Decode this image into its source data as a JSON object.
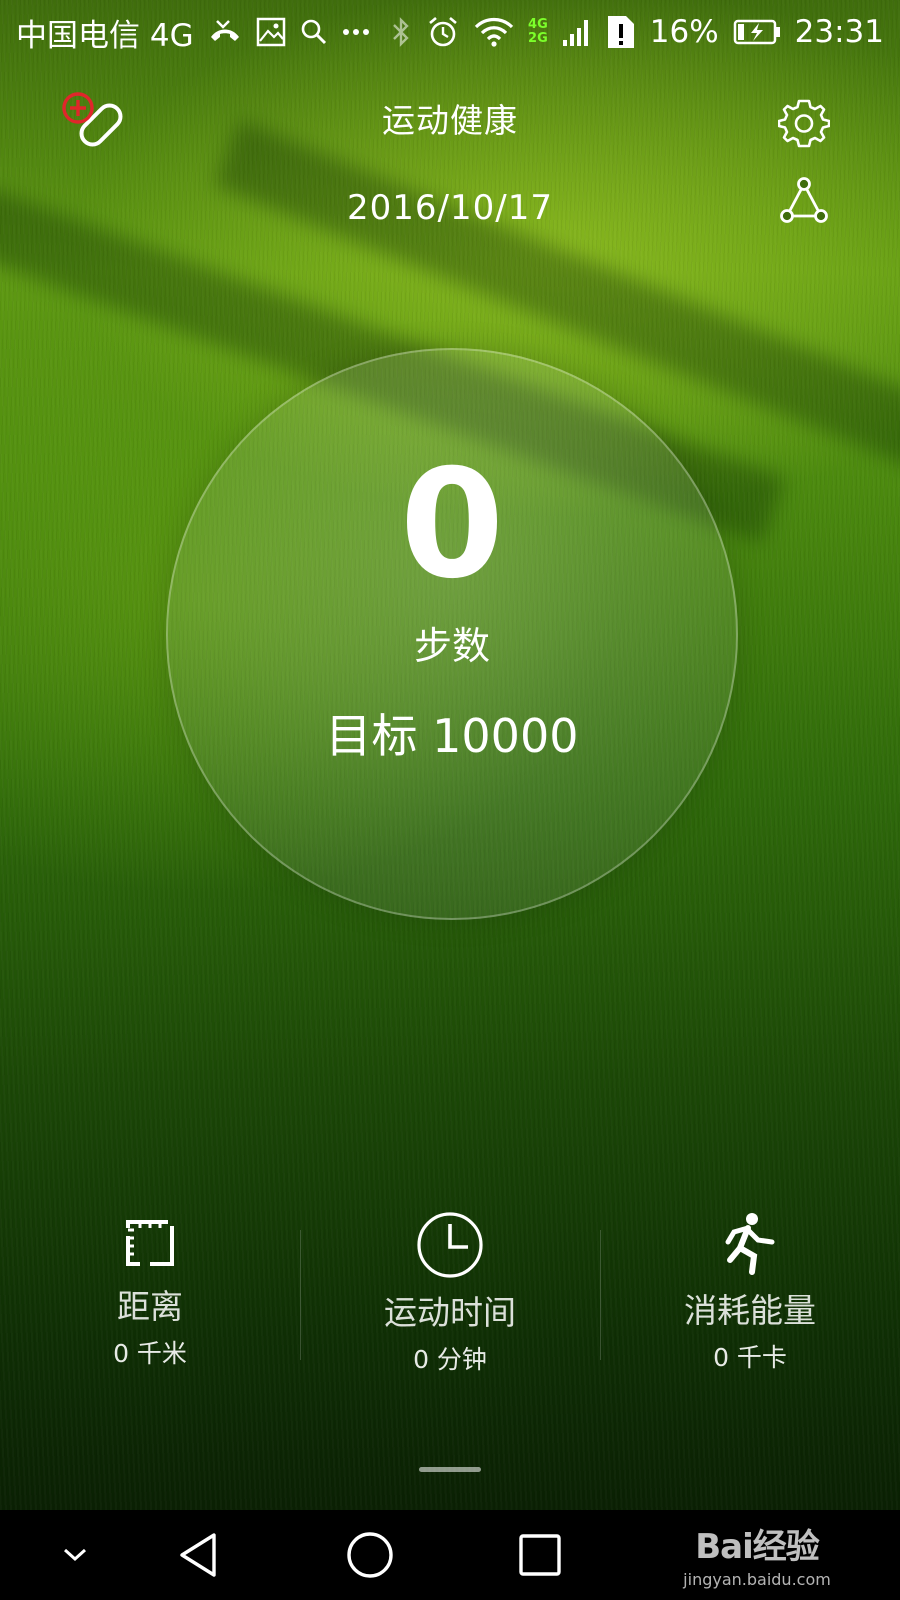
{
  "status_bar": {
    "carrier": "中国电信 4G",
    "net_tags": [
      "4G",
      "2G"
    ],
    "battery_percent": "16%",
    "time": "23:31"
  },
  "header": {
    "title": "运动健康",
    "date": "2016/10/17"
  },
  "steps": {
    "count": "0",
    "label": "步数",
    "goal": "目标 10000"
  },
  "stats": [
    {
      "label": "距离",
      "value": "0 千米",
      "icon": "distance-icon"
    },
    {
      "label": "运动时间",
      "value": "0 分钟",
      "icon": "clock-icon"
    },
    {
      "label": "消耗能量",
      "value": "0 千卡",
      "icon": "running-icon"
    }
  ],
  "watermark": {
    "brand": "Bai经验",
    "url": "jingyan.baidu.com"
  },
  "colors": {
    "accent_red": "#e0262b",
    "net_green": "#7cff2a",
    "grass_dark": "#0f2f04",
    "grass_light": "#5f9a12"
  }
}
